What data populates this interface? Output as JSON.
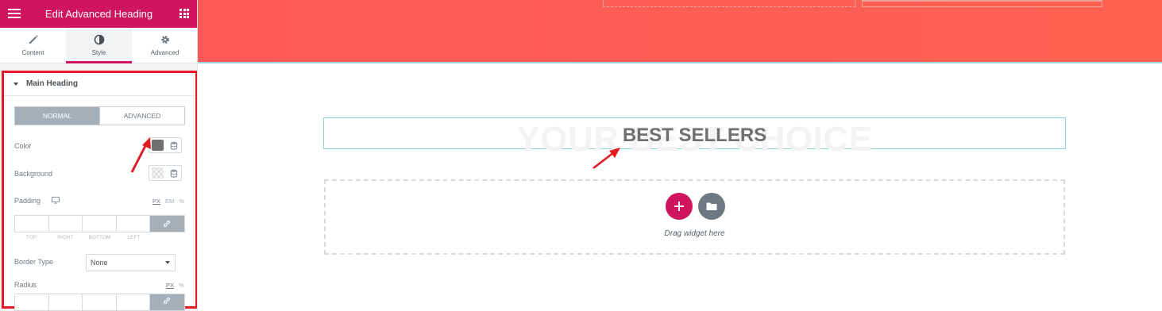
{
  "sidebar": {
    "title": "Edit Advanced Heading",
    "tabs": [
      {
        "label": "Content",
        "icon": "pencil-icon"
      },
      {
        "label": "Style",
        "icon": "contrast-icon"
      },
      {
        "label": "Advanced",
        "icon": "gear-icon"
      }
    ],
    "active_tab": "Style",
    "section_title": "Main Heading",
    "state_toggle": {
      "normal": "NORMAL",
      "advanced": "ADVANCED",
      "active": "NORMAL"
    },
    "controls": {
      "color_label": "Color",
      "color_value": "#6f6f6f",
      "background_label": "Background",
      "padding_label": "Padding",
      "padding_units": [
        "PX",
        "EM",
        "%"
      ],
      "padding_sides": [
        "TOP",
        "RIGHT",
        "BOTTOM",
        "LEFT"
      ],
      "border_type_label": "Border Type",
      "border_type_value": "None",
      "radius_label": "Radius",
      "radius_units": [
        "PX",
        "%"
      ]
    }
  },
  "canvas": {
    "heading_background_text": "YOUR BEST CHOICE",
    "heading_text": "BEST SELLERS",
    "drop_zone_text": "Drag widget here"
  },
  "colors": {
    "brand": "#d0155e",
    "hero": "#fd5a57",
    "highlight_border": "#e41b23",
    "annotation_arrow": "#e41b23"
  }
}
